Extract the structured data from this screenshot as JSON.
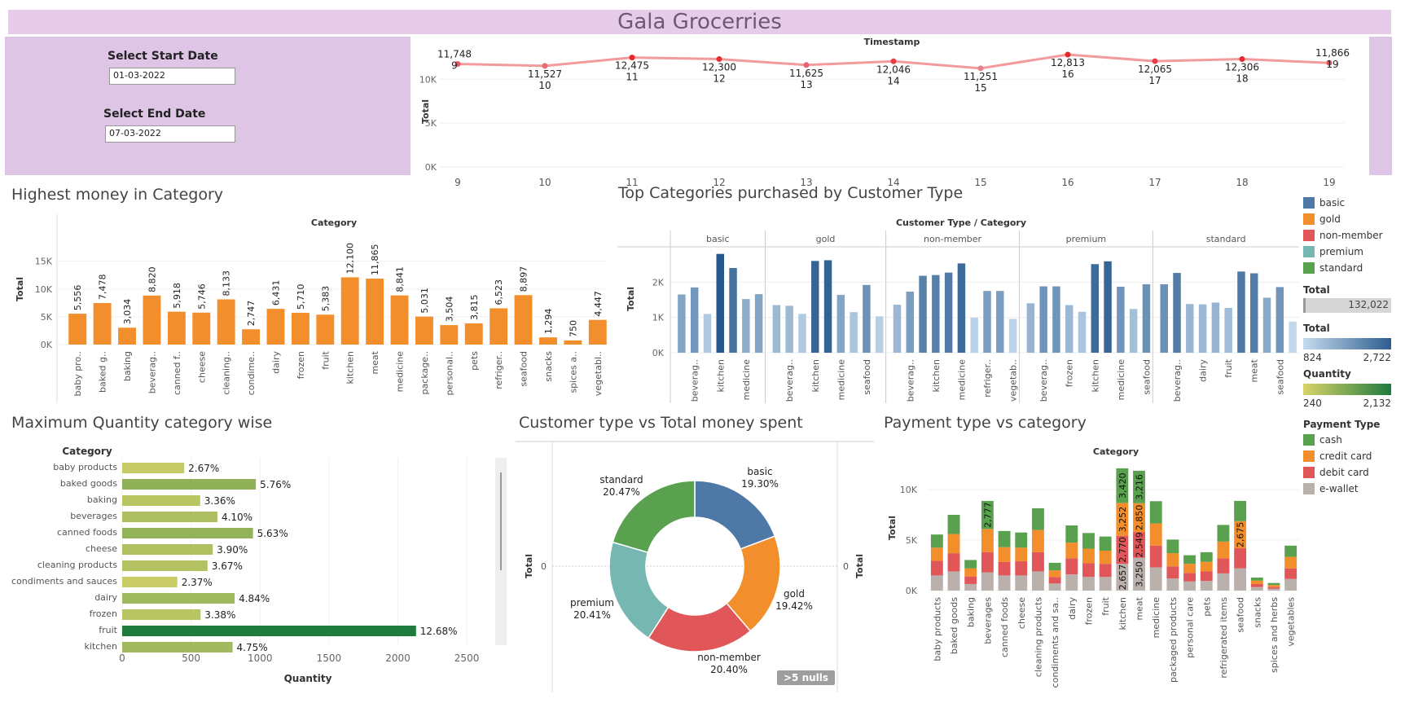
{
  "app_title": "Gala Grocerries",
  "filters": {
    "start_label": "Select Start Date",
    "start_value": "01-03-2022",
    "end_label": "Select End Date",
    "end_value": "07-03-2022"
  },
  "colors": {
    "basic": "#4e79a7",
    "gold": "#f28e2b",
    "non_member": "#e15759",
    "premium": "#76b7b2",
    "standard": "#59a14f",
    "bar_orange": "#f28e2b",
    "cash": "#59a14f",
    "credit_card": "#f28e2b",
    "debit_card": "#e15759",
    "e_wallet": "#bab0ac",
    "line_red": "#e8333a"
  },
  "titles": {
    "highest_money": "Highest money in Category",
    "top_categories": "Top Categories purchased by  Customer Type",
    "max_quantity": "Maximum Quantity category wise",
    "customer_type_money": "Customer type vs Total money spent",
    "payment_type": "Payment type vs  category"
  },
  "legends": {
    "customer_types": [
      "basic",
      "gold",
      "non-member",
      "premium",
      "standard"
    ],
    "total_label": "Total",
    "total_value": "132,022",
    "total2_label": "Total",
    "total2_min": "824",
    "total2_max": "2,722",
    "quantity_label": "Quantity",
    "quantity_min": "240",
    "quantity_max": "2,132",
    "payment_title": "Payment Type",
    "payment_types": [
      "cash",
      "credit card",
      "debit card",
      "e-wallet"
    ]
  },
  "null_badge": ">5 nulls",
  "chart_data": [
    {
      "id": "timestamp_line",
      "type": "line",
      "title": "Timestamp",
      "ylabel": "Total",
      "x": [
        "9",
        "10",
        "11",
        "12",
        "13",
        "14",
        "15",
        "16",
        "17",
        "18",
        "19"
      ],
      "values": [
        11748,
        11527,
        12475,
        12300,
        11625,
        12046,
        11251,
        12813,
        12065,
        12306,
        11866
      ],
      "value_labels": [
        "11,748",
        "11,527",
        "12,475",
        "12,300",
        "11,625",
        "12,046",
        "11,251",
        "12,813",
        "12,065",
        "12,306",
        "11,866"
      ],
      "yticks": [
        "0K",
        "5K",
        "10K"
      ],
      "ylim": [
        0,
        13000
      ]
    },
    {
      "id": "highest_money",
      "type": "bar",
      "title": "Category",
      "ylabel": "Total",
      "categories": [
        "baby pro..",
        "baked g..",
        "baking",
        "beverag..",
        "canned f..",
        "cheese",
        "cleaning..",
        "condime..",
        "dairy",
        "frozen",
        "fruit",
        "kitchen",
        "meat",
        "medicine",
        "package..",
        "personal..",
        "pets",
        "refriger..",
        "seafood",
        "snacks",
        "spices a..",
        "vegetabl.."
      ],
      "values": [
        5556,
        7478,
        3034,
        8820,
        5918,
        5746,
        8133,
        2747,
        6431,
        5710,
        5383,
        12100,
        11865,
        8841,
        5031,
        3504,
        3815,
        6523,
        8897,
        1294,
        750,
        4447
      ],
      "value_labels": [
        "5,556",
        "7,478",
        "3,034",
        "8,820",
        "5,918",
        "5,746",
        "8,133",
        "2,747",
        "6,431",
        "5,710",
        "5,383",
        "12,100",
        "11,865",
        "8,841",
        "5,031",
        "3,504",
        "3,815",
        "6,523",
        "8,897",
        "1,294",
        "750",
        "4,447"
      ],
      "yticks": [
        "0K",
        "5K",
        "10K",
        "15K"
      ],
      "ylim": [
        0,
        17000
      ]
    },
    {
      "id": "top_categories",
      "type": "bar",
      "title": "Customer Type / Category",
      "ylabel": "Total",
      "yticks": [
        "0K",
        "1K",
        "2K"
      ],
      "ylim": [
        0,
        3000
      ],
      "groups": [
        {
          "name": "basic",
          "values": [
            1650,
            1850,
            1100,
            2800,
            2400,
            1520,
            1660
          ],
          "labels": [
            "",
            "beverag..",
            "",
            "kitchen",
            "",
            "medicine",
            ""
          ]
        },
        {
          "name": "gold",
          "values": [
            1350,
            1330,
            1100,
            2600,
            2620,
            1640,
            1150,
            1920,
            1030
          ],
          "labels": [
            "",
            "beverag..",
            "",
            "kitchen",
            "",
            "medicine",
            "",
            "seafood",
            ""
          ]
        },
        {
          "name": "non-member",
          "values": [
            1360,
            1730,
            2180,
            2200,
            2270,
            2530,
            990,
            1750,
            1750,
            960
          ],
          "labels": [
            "",
            "beverag..",
            "",
            "kitchen",
            "",
            "medicine",
            "",
            "refriger..",
            "",
            "vegetab.."
          ]
        },
        {
          "name": "premium",
          "values": [
            1400,
            1880,
            1880,
            1350,
            1160,
            2510,
            2590,
            1870,
            1240,
            1940
          ],
          "labels": [
            "",
            "beverag..",
            "",
            "frozen",
            "",
            "kitchen",
            "",
            "medicine",
            "",
            "seafood"
          ]
        },
        {
          "name": "standard",
          "values": [
            1940,
            2260,
            1380,
            1370,
            1420,
            1270,
            2300,
            2250,
            1560,
            1860,
            880
          ],
          "labels": [
            "",
            "beverag..",
            "",
            "dairy",
            "",
            "fruit",
            "",
            "meat",
            "",
            "seafood",
            ""
          ]
        }
      ]
    },
    {
      "id": "max_quantity",
      "type": "bar",
      "orientation": "horizontal",
      "title": "Category",
      "xlabel": "Quantity",
      "categories": [
        "baby products",
        "baked goods",
        "baking",
        "beverages",
        "canned foods",
        "cheese",
        "cleaning products",
        "condiments and sauces",
        "dairy",
        "frozen",
        "fruit",
        "kitchen"
      ],
      "values": [
        450,
        970,
        566,
        691,
        949,
        657,
        619,
        400,
        816,
        569,
        2132,
        801
      ],
      "value_labels": [
        "2.67%",
        "5.76%",
        "3.36%",
        "4.10%",
        "5.63%",
        "3.90%",
        "3.67%",
        "2.37%",
        "4.84%",
        "3.38%",
        "12.68%",
        "4.75%"
      ],
      "xticks": [
        "0",
        "500",
        "1000",
        "1500",
        "2000",
        "2500"
      ],
      "xlim": [
        0,
        2600
      ]
    },
    {
      "id": "customer_type_money",
      "type": "pie",
      "categories": [
        "basic",
        "gold",
        "non-member",
        "premium",
        "standard"
      ],
      "percent_labels": [
        "19.30%",
        "19.42%",
        "20.40%",
        "20.41%",
        "20.47%"
      ],
      "values": [
        19.3,
        19.42,
        20.4,
        20.41,
        20.47
      ],
      "left_axis_label": "Total",
      "right_axis_label": "Total",
      "zero_label": "0"
    },
    {
      "id": "payment_type",
      "type": "bar",
      "stacked": true,
      "title": "Category",
      "ylabel": "Total",
      "yticks": [
        "0K",
        "5K",
        "10K"
      ],
      "ylim": [
        0,
        12500
      ],
      "categories": [
        "baby products",
        "baked goods",
        "baking",
        "beverages",
        "canned foods",
        "cheese",
        "cleaning products",
        "condiments and sa..",
        "dairy",
        "frozen",
        "fruit",
        "kitchen",
        "meat",
        "medicine",
        "packaged products",
        "personal care",
        "pets",
        "refrigerated items",
        "seafood",
        "snacks",
        "spices and herbs",
        "vegetables"
      ],
      "series": [
        {
          "name": "e-wallet",
          "values": [
            1500,
            1900,
            650,
            1800,
            1500,
            1500,
            1900,
            700,
            1600,
            1350,
            1350,
            2657,
            3250,
            2300,
            1200,
            900,
            950,
            1700,
            2200,
            350,
            180,
            1150
          ]
        },
        {
          "name": "debit card",
          "values": [
            1450,
            1800,
            750,
            2000,
            1350,
            1400,
            1900,
            650,
            1600,
            1350,
            1300,
            2770,
            2549,
            2150,
            1200,
            850,
            950,
            1500,
            2000,
            300,
            170,
            1050
          ]
        },
        {
          "name": "credit card",
          "values": [
            1300,
            1900,
            800,
            2300,
            1450,
            1350,
            2200,
            650,
            1550,
            1450,
            1300,
            3252,
            2850,
            2200,
            1300,
            900,
            950,
            1650,
            2675,
            340,
            200,
            1150
          ]
        },
        {
          "name": "cash",
          "values": [
            1300,
            1900,
            830,
            2777,
            1600,
            1500,
            2150,
            750,
            1700,
            1550,
            1400,
            3420,
            3216,
            2200,
            1350,
            850,
            950,
            1650,
            2000,
            300,
            200,
            1100
          ]
        }
      ],
      "shown_labels": {
        "beverages": {
          "cash": "2,777"
        },
        "kitchen": {
          "e-wallet": "2,657",
          "debit card": "2,770",
          "credit card": "3,252",
          "cash": "3,420"
        },
        "meat": {
          "e-wallet": "3,250",
          "debit card": "2,549",
          "credit card": "2,850",
          "cash": "3,216"
        },
        "seafood": {
          "credit card": "2,675"
        }
      }
    }
  ]
}
